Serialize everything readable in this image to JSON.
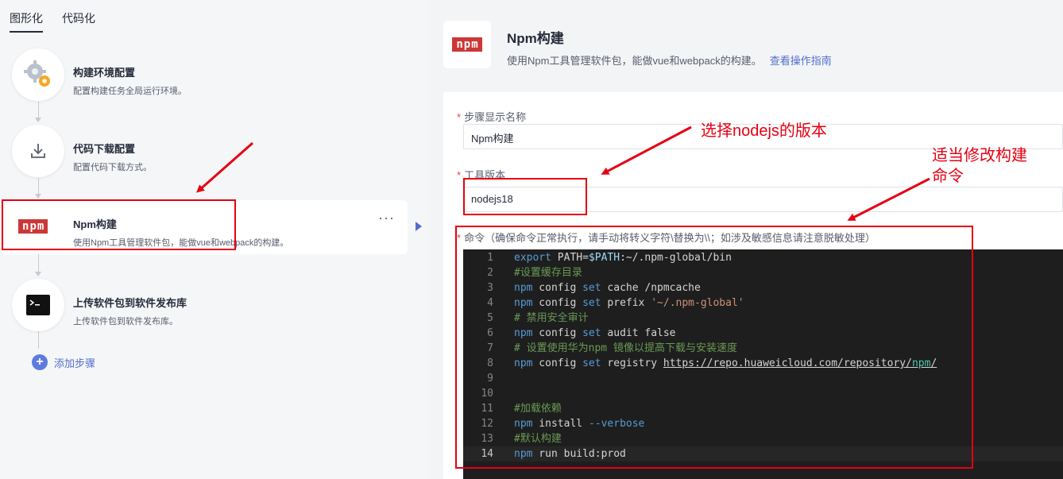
{
  "tabs": [
    {
      "label": "图形化",
      "active": true
    },
    {
      "label": "代码化",
      "active": false
    }
  ],
  "steps": [
    {
      "title": "构建环境配置",
      "desc": "配置构建任务全局运行环境。",
      "icon": "gears-icon"
    },
    {
      "title": "代码下载配置",
      "desc": "配置代码下载方式。",
      "icon": "download-icon"
    },
    {
      "title": "Npm构建",
      "desc": "使用Npm工具管理软件包，能做vue和webpack的构建。",
      "icon": "npm-logo-icon",
      "more": "···"
    },
    {
      "title": "上传软件包到软件发布库",
      "desc": "上传软件包到软件发布库。",
      "icon": "terminal-icon"
    }
  ],
  "add_step": {
    "icon": "+",
    "label": "添加步骤"
  },
  "plugin": {
    "logo_text": [
      "n",
      "p",
      "m"
    ],
    "title": "Npm构建",
    "desc": "使用Npm工具管理软件包，能做vue和webpack的构建。",
    "link": "查看操作指南"
  },
  "form": {
    "required_mark": "*",
    "step_name_label": "步骤显示名称",
    "step_name_value": "Npm构建",
    "tool_version_label": "工具版本",
    "tool_version_value": "nodejs18",
    "command_label": "命令（确保命令正常执行，请手动将转义字符\\替换为\\\\；如涉及敏感信息请注意脱敏处理）"
  },
  "code_lines": [
    {
      "n": "1",
      "text": "export PATH=$PATH:~/.npm-global/bin"
    },
    {
      "n": "2",
      "text": "#设置缓存目录"
    },
    {
      "n": "3",
      "text": "npm config set cache /npmcache"
    },
    {
      "n": "4",
      "text": "npm config set prefix '~/.npm-global'"
    },
    {
      "n": "5",
      "text": "# 禁用安全审计"
    },
    {
      "n": "6",
      "text": "npm config set audit false"
    },
    {
      "n": "7",
      "text": "# 设置使用华为npm 镜像以提高下载与安装速度"
    },
    {
      "n": "8",
      "text": "npm config set registry https://repo.huaweicloud.com/repository/npm/"
    },
    {
      "n": "9",
      "text": ""
    },
    {
      "n": "10",
      "text": ""
    },
    {
      "n": "11",
      "text": "#加载依赖"
    },
    {
      "n": "12",
      "text": "npm install --verbose"
    },
    {
      "n": "13",
      "text": "#默认构建"
    },
    {
      "n": "14",
      "text": "npm run build:prod"
    }
  ],
  "annotations": {
    "nodejs_note": "选择nodejs的版本",
    "command_note_line1": "适当修改构建",
    "command_note_line2": "命令"
  },
  "colors": {
    "accent": "#526ecc",
    "annotation": "#e60012",
    "npm": "#cb3837",
    "editor_bg": "#1e1e1e"
  }
}
